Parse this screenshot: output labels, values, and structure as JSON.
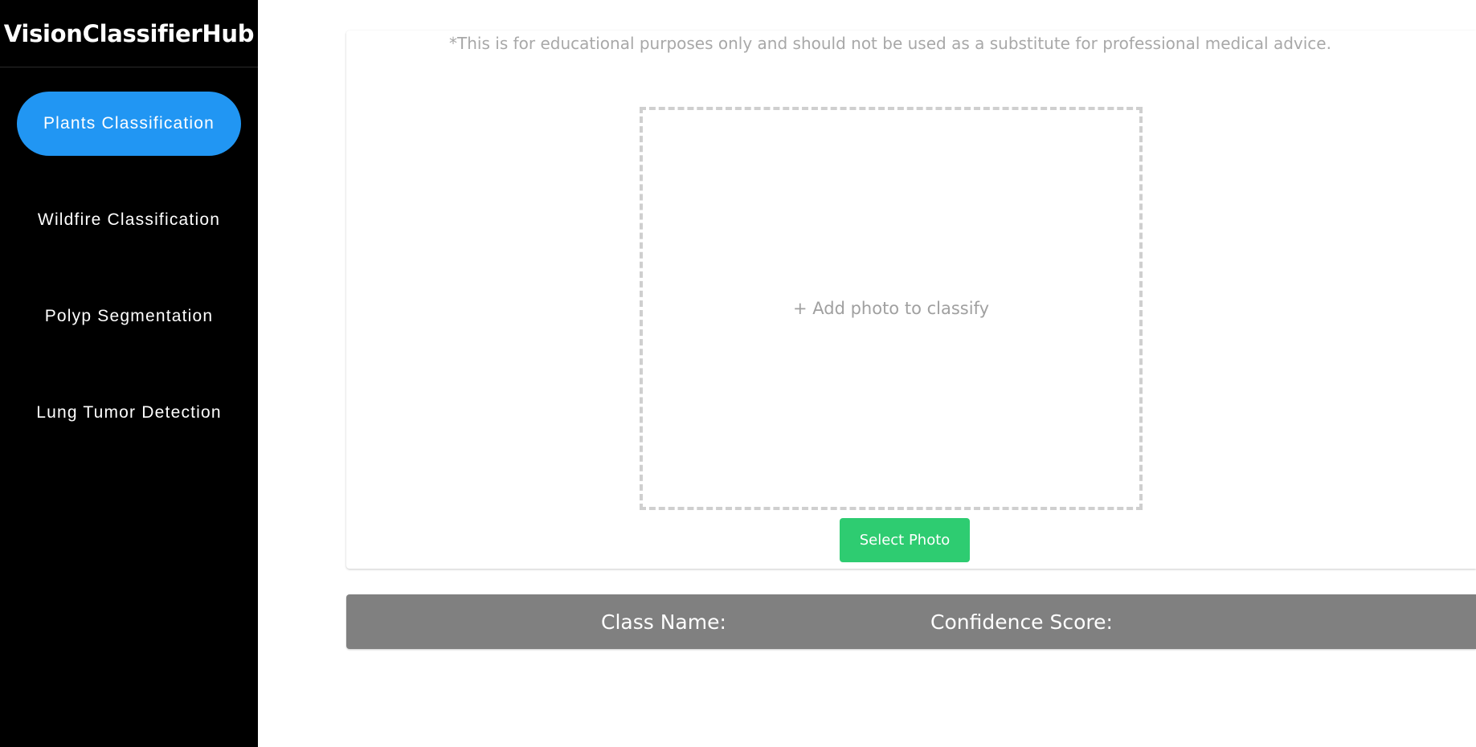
{
  "app": {
    "title": "VisionClassifierHub"
  },
  "sidebar": {
    "items": [
      {
        "label": "Plants Classification",
        "active": true
      },
      {
        "label": "Wildfire Classification",
        "active": false
      },
      {
        "label": "Polyp Segmentation",
        "active": false
      },
      {
        "label": "Lung Tumor Detection",
        "active": false
      }
    ]
  },
  "main": {
    "disclaimer": "*This is for educational purposes only and should not be used as a substitute for professional medical advice.",
    "dropzone": {
      "label": "+ Add photo to classify"
    },
    "select_button": "Select Photo",
    "result": {
      "class_name_label": "Class Name:",
      "confidence_label": "Confidence Score:"
    }
  },
  "colors": {
    "sidebar_bg": "#000000",
    "active_nav": "#2196f3",
    "select_button": "#2ecc71",
    "result_bar": "#808080",
    "dropzone_border": "#cfcfcf"
  }
}
